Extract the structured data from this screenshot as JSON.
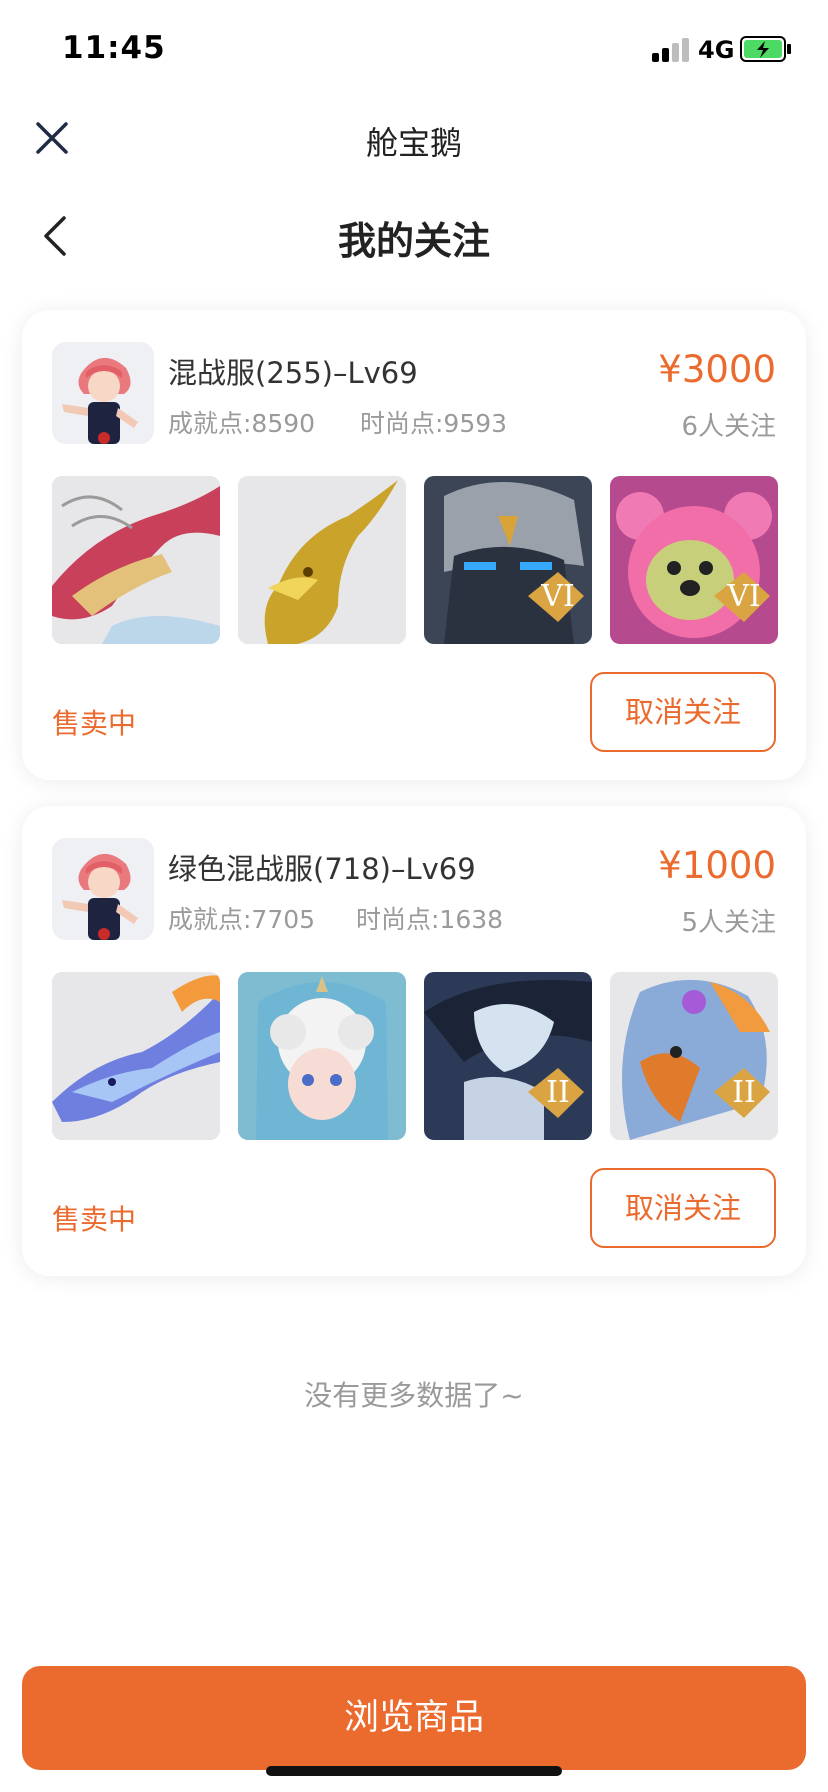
{
  "status_bar": {
    "time": "11:45",
    "network": "4G"
  },
  "nav": {
    "title": "舱宝鹅",
    "close_icon": "close-icon"
  },
  "header": {
    "title": "我的关注",
    "back_icon": "chevron-left-icon"
  },
  "listings": [
    {
      "server": "混战服(255)–Lv69",
      "achievement_label": "成就点:8590",
      "fashion_label": "时尚点:9593",
      "price": "¥3000",
      "followers": "6人关注",
      "status": "售卖中",
      "unfollow_label": "取消关注",
      "items": [
        {
          "icon": "red-dragon-icon",
          "badge": ""
        },
        {
          "icon": "golden-phoenix-icon",
          "badge": ""
        },
        {
          "icon": "stone-golem-icon",
          "badge": "VI"
        },
        {
          "icon": "pink-bear-icon",
          "badge": "VI"
        }
      ]
    },
    {
      "server": "绿色混战服(718)–Lv69",
      "achievement_label": "成就点:7705",
      "fashion_label": "时尚点:1638",
      "price": "¥1000",
      "followers": "5人关注",
      "status": "售卖中",
      "unfollow_label": "取消关注",
      "items": [
        {
          "icon": "blue-dragon-icon",
          "badge": ""
        },
        {
          "icon": "cloud-doll-icon",
          "badge": ""
        },
        {
          "icon": "ice-dragon-rider-icon",
          "badge": "II"
        },
        {
          "icon": "eagle-icon",
          "badge": "II"
        }
      ]
    }
  ],
  "footer": {
    "no_more": "没有更多数据了~",
    "browse_label": "浏览商品"
  },
  "colors": {
    "accent": "#eb6a2d",
    "muted": "#9a9a9a"
  }
}
